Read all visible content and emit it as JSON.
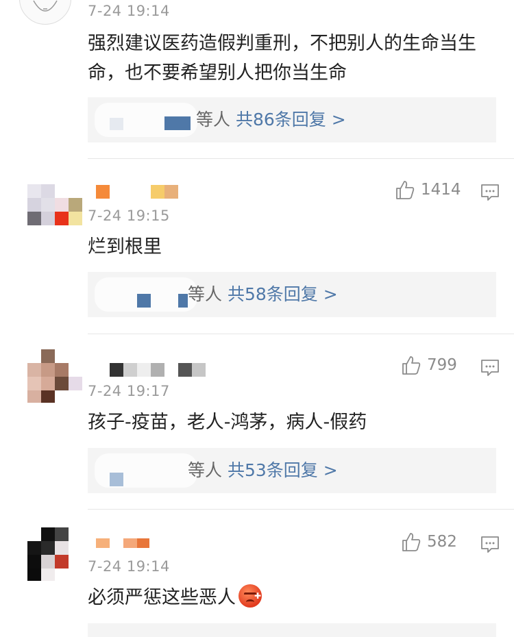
{
  "comments": [
    {
      "time": "7-24 19:14",
      "text": "强烈建议医药造假判重刑，不把别人的生命当生命，也不要希望别人把你当生命",
      "reply_who": "等人",
      "reply_count": "共86条回复 >"
    },
    {
      "time": "7-24 19:15",
      "text": "烂到根里",
      "likes": "1414",
      "reply_who": "等人",
      "reply_count": "共58条回复 >"
    },
    {
      "time": "7-24 19:17",
      "text": "孩子-疫苗，老人-鸿茅，病人-假药",
      "likes": "799",
      "reply_who": "等人",
      "reply_count": "共53条回复 >"
    },
    {
      "time": "7-24 19:14",
      "text": "必须严惩这些恶人",
      "likes": "582",
      "emoji": "angry-face-emoji"
    }
  ],
  "icons": {
    "like": "thumbs-up-icon",
    "comment": "comment-bubble-icon"
  },
  "colors": {
    "link": "#4f78a8",
    "meta": "#9a9a9a",
    "reply_bg": "#f4f4f4"
  }
}
